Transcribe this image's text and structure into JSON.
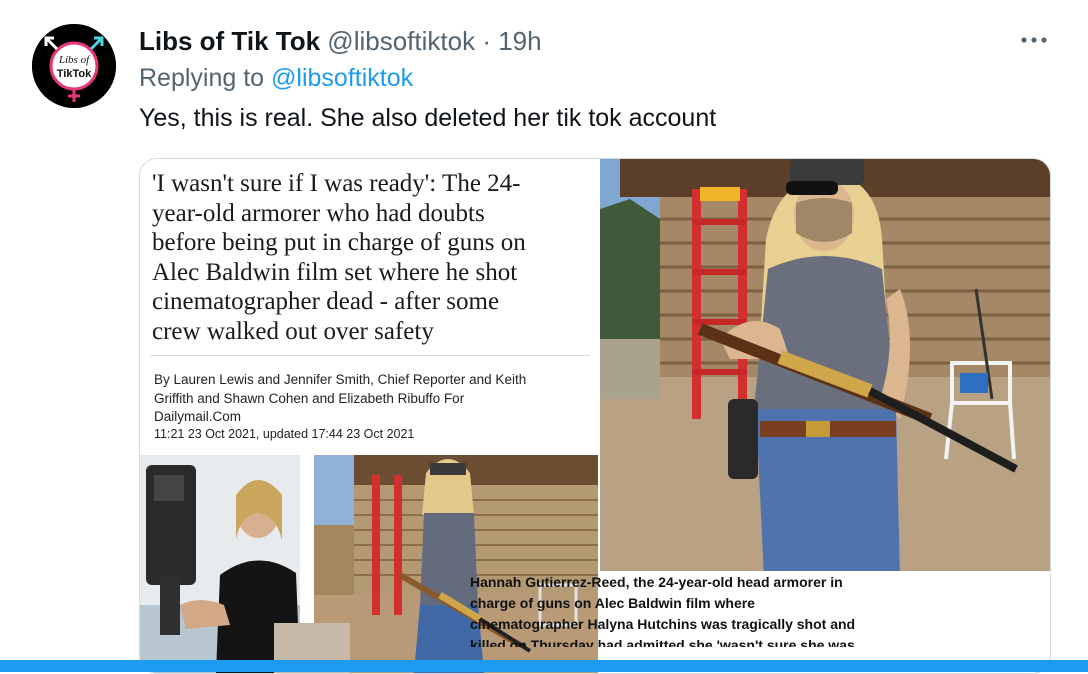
{
  "author": {
    "name": "Libs of Tik Tok",
    "handle": "@libsoftiktok",
    "separator": "·",
    "time": "19h",
    "avatar_text": "Libs of TikTok"
  },
  "reply": {
    "prefix": "Replying to",
    "handle": "@libsoftiktok"
  },
  "tweet": {
    "text": "Yes, this is real. She also deleted her tik tok account"
  },
  "media": {
    "headline_lines": [
      "'I wasn't sure if I was ready': The 24-",
      "year-old armorer who had doubts",
      "before being put in charge of guns on",
      "Alec Baldwin film set where he shot",
      "cinematographer dead - after some",
      "crew walked out over safety"
    ],
    "byline_lines": [
      "By Lauren Lewis and Jennifer Smith, Chief Reporter and Keith",
      "Griffith and Shawn Cohen and Elizabeth Ribuffo For",
      "Dailymail.Com"
    ],
    "dateline": "11:21 23 Oct 2021, updated 17:44 23 Oct 2021",
    "caption_lines": [
      "Hannah Gutierrez-Reed, the 24-year-old head armorer in",
      "charge of guns on Alec Baldwin film where",
      "cinematographer Halyna Hutchins was tragically shot and",
      "killed on Thursday had admitted she 'wasn't sure she was"
    ]
  },
  "colors": {
    "link": "#1d9bf0",
    "secondary_text": "#536471",
    "primary_text": "#0f1419",
    "border": "#cfd9de"
  },
  "icons": {
    "more": "more-horizontal-icon"
  }
}
